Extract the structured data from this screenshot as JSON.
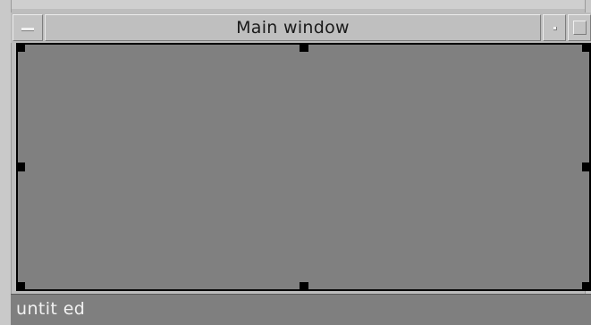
{
  "window": {
    "title": "Main window"
  },
  "statusbar": {
    "text": "untit ed"
  },
  "icons": {
    "window_menu": "window-menu-icon",
    "minimize": "minimize-icon",
    "maximize": "maximize-icon"
  },
  "colors": {
    "canvas": "#808080",
    "frame": "#bdbdbd",
    "selection_border": "#000000",
    "status_bg": "#7f7f7f",
    "status_text": "#f2f2f2"
  }
}
